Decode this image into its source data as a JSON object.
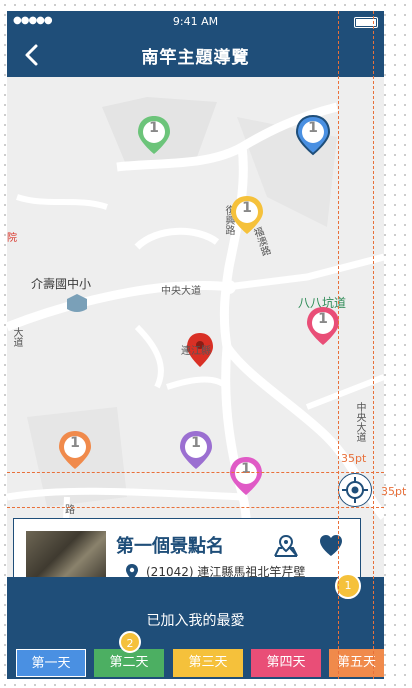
{
  "status_bar": {
    "signal": "●●●●●",
    "time": "9:41 AM"
  },
  "nav": {
    "title": "南竿主題導覽"
  },
  "map": {
    "labels": {
      "school": "介壽國中小",
      "road_zhongyang": "中央大道",
      "town": "連江縣",
      "bay": "八八坑道",
      "left_edge": "院",
      "road_left": "大道",
      "road_right": "中央大道",
      "road_vertical": "復興路",
      "road_vertical2": "福澳路",
      "road_bottom": "路"
    },
    "pins": [
      {
        "value": "1",
        "color": "#6cc47a"
      },
      {
        "value": "1",
        "color": "#4a90e2"
      },
      {
        "value": "1",
        "color": "#f5c13b"
      },
      {
        "value": "1",
        "color": "#e94e77"
      },
      {
        "value": "1",
        "color": "#f08a4b"
      },
      {
        "value": "1",
        "color": "#9b6fd1"
      },
      {
        "value": "1",
        "color": "#e05ac6"
      }
    ]
  },
  "guides": {
    "label_top": "35pt",
    "label_right": "35pt"
  },
  "card": {
    "name": "第一個景點名",
    "address": "(21042) 連江縣馬祖北竿芹壁"
  },
  "favorites": {
    "title": "已加入我的最愛",
    "badge_main": "1",
    "badge_day": "2",
    "days": [
      {
        "label": "第一天",
        "color": "#4a90e2"
      },
      {
        "label": "第二天",
        "color": "#4caf62"
      },
      {
        "label": "第三天",
        "color": "#f5c13b"
      },
      {
        "label": "第四天",
        "color": "#e94e77"
      },
      {
        "label": "第五天",
        "color": "#f08a4b"
      }
    ]
  },
  "colors": {
    "primary": "#1f4e79",
    "guide": "#e8703a"
  }
}
